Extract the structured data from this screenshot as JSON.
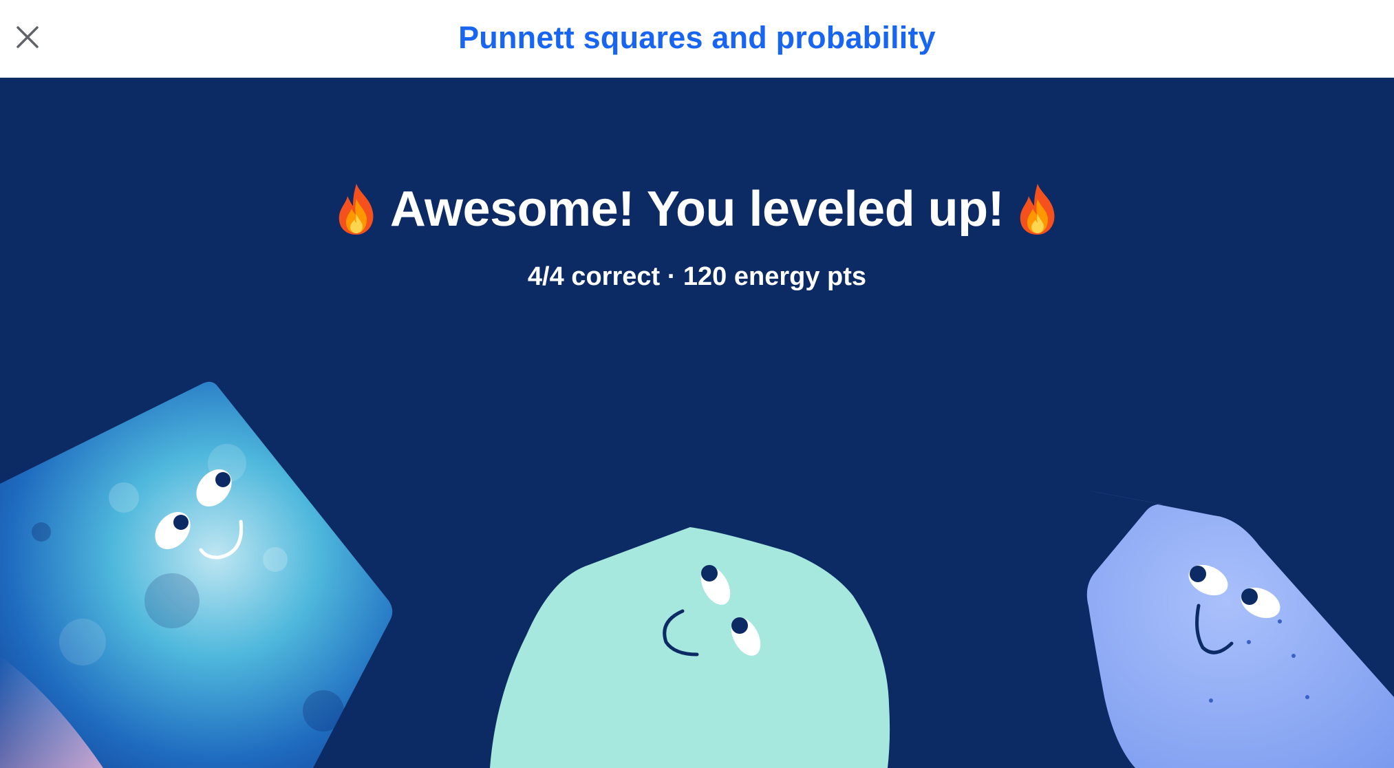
{
  "header": {
    "title": "Punnett squares and probability",
    "close_icon": "close-icon"
  },
  "celebration": {
    "headline": "Awesome! You leveled up!",
    "summary": "4/4 correct · 120 energy pts",
    "decor_icon": "fire-emoji"
  },
  "colors": {
    "header_title": "#1865f2",
    "stage_background": "#0c2a64",
    "creature_left": "#2a8fd0",
    "creature_middle": "#a6e7de",
    "creature_right": "#8eacf6"
  }
}
